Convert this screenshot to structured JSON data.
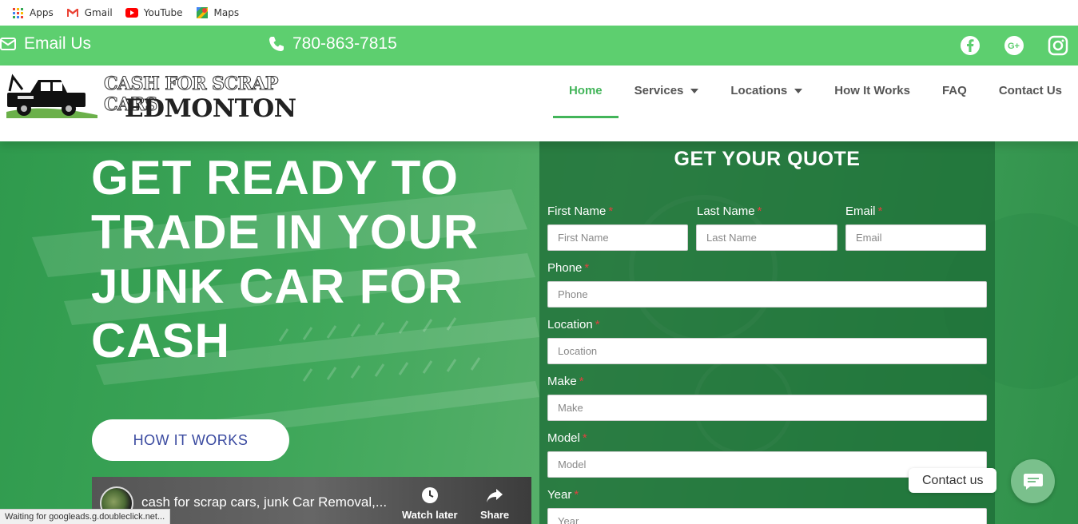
{
  "bookmarks": [
    {
      "label": "Apps",
      "icon": "apps-grid-icon"
    },
    {
      "label": "Gmail",
      "icon": "gmail-icon"
    },
    {
      "label": "YouTube",
      "icon": "youtube-icon"
    },
    {
      "label": "Maps",
      "icon": "maps-icon"
    }
  ],
  "topbar": {
    "email_label": "Email Us",
    "phone_label": "780-863-7815",
    "socials": [
      "facebook-icon",
      "google-plus-icon",
      "instagram-icon"
    ]
  },
  "logo": {
    "line1": "CASH FOR SCRAP CARS",
    "line2": "EDMONTON"
  },
  "nav": {
    "items": [
      {
        "label": "Home",
        "active": true,
        "dropdown": false
      },
      {
        "label": "Services",
        "active": false,
        "dropdown": true
      },
      {
        "label": "Locations",
        "active": false,
        "dropdown": true
      },
      {
        "label": "How It Works",
        "active": false,
        "dropdown": false
      },
      {
        "label": "FAQ",
        "active": false,
        "dropdown": false
      },
      {
        "label": "Contact Us",
        "active": false,
        "dropdown": false
      }
    ]
  },
  "hero": {
    "title": "GET READY TO TRADE IN YOUR JUNK CAR FOR CASH",
    "button_label": "HOW IT WORKS"
  },
  "video": {
    "title": "cash for scrap cars, junk Car Removal,...",
    "watch_later": "Watch later",
    "share": "Share"
  },
  "form": {
    "title": "GET YOUR QUOTE",
    "required_mark": "*",
    "fields": {
      "first_name": {
        "label": "First Name",
        "placeholder": "First Name"
      },
      "last_name": {
        "label": "Last Name",
        "placeholder": "Last Name"
      },
      "email": {
        "label": "Email",
        "placeholder": "Email"
      },
      "phone": {
        "label": "Phone",
        "placeholder": "Phone"
      },
      "location": {
        "label": "Location",
        "placeholder": "Location"
      },
      "make": {
        "label": "Make",
        "placeholder": "Make"
      },
      "model": {
        "label": "Model",
        "placeholder": "Model"
      },
      "year": {
        "label": "Year",
        "placeholder": "Year"
      }
    }
  },
  "status_bar": "Waiting for googleads.g.doubleclick.net...",
  "contact_widget": {
    "label": "Contact us"
  },
  "colors": {
    "topbar_green": "#5dcf6f",
    "nav_active": "#43b55a",
    "required_red": "#e0413f",
    "button_text": "#3a4aa0"
  }
}
